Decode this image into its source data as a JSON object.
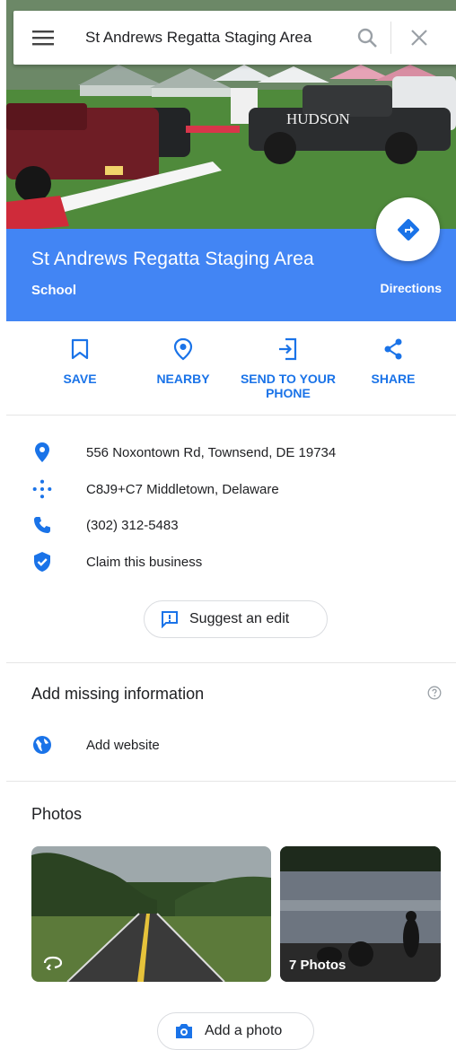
{
  "search": {
    "query": "St Andrews Regatta Staging Area",
    "menu_icon": "hamburger-menu-icon",
    "search_icon": "search-icon",
    "close_icon": "close-icon"
  },
  "hero": {
    "truck_text": "HUDSON"
  },
  "place": {
    "name": "St Andrews Regatta Staging Area",
    "category": "School",
    "directions_label": "Directions"
  },
  "actions": [
    {
      "label": "SAVE",
      "icon": "bookmark-icon"
    },
    {
      "label": "NEARBY",
      "icon": "nearby-pin-icon"
    },
    {
      "label": "SEND TO YOUR PHONE",
      "icon": "send-to-phone-icon"
    },
    {
      "label": "SHARE",
      "icon": "share-icon"
    }
  ],
  "info": {
    "address": "556 Noxontown Rd, Townsend, DE 19734",
    "plus_code": "C8J9+C7 Middletown, Delaware",
    "phone": "(302) 312-5483",
    "claim": "Claim this business"
  },
  "suggest_edit": "Suggest an edit",
  "missing": {
    "title": "Add missing information",
    "website": "Add website"
  },
  "photos": {
    "title": "Photos",
    "count_label": "7 Photos",
    "add_photo": "Add a photo"
  },
  "colors": {
    "accent": "#4285f4",
    "link": "#1a73e8"
  }
}
